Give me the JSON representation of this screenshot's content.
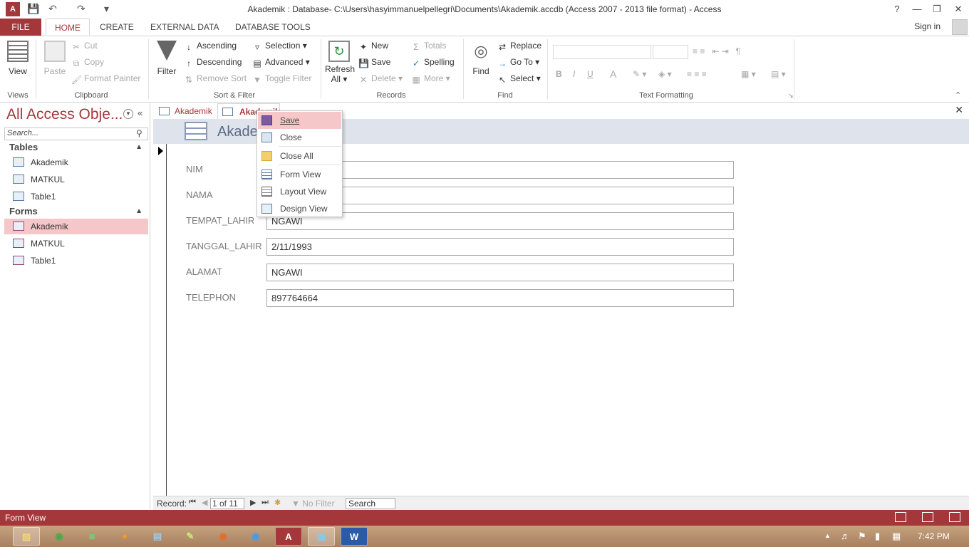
{
  "title_bar": {
    "app_icon": "A",
    "title": "Akademik : Database- C:\\Users\\hasyimmanuelpellegri\\Documents\\Akademik.accdb (Access 2007 - 2013 file format) - Access",
    "help": "?"
  },
  "ribbon_tabs": [
    "FILE",
    "HOME",
    "CREATE",
    "EXTERNAL DATA",
    "DATABASE TOOLS"
  ],
  "sign_in": "Sign in",
  "ribbon": {
    "views": {
      "view": "View",
      "label": "Views"
    },
    "clipboard": {
      "paste": "Paste",
      "cut": "Cut",
      "copy": "Copy",
      "format_painter": "Format Painter",
      "label": "Clipboard"
    },
    "sort_filter": {
      "filter": "Filter",
      "ascending": "Ascending",
      "descending": "Descending",
      "remove_sort": "Remove Sort",
      "selection": "Selection",
      "advanced": "Advanced",
      "toggle_filter": "Toggle Filter",
      "label": "Sort & Filter"
    },
    "records": {
      "refresh": "Refresh",
      "refresh_all": "All",
      "new": "New",
      "save": "Save",
      "delete": "Delete",
      "totals": "Totals",
      "spelling": "Spelling",
      "more": "More",
      "label": "Records"
    },
    "find": {
      "find": "Find",
      "replace": "Replace",
      "goto": "Go To",
      "select": "Select",
      "label": "Find"
    },
    "text_formatting": {
      "bold": "B",
      "italic": "I",
      "underline": "U",
      "font_color": "A",
      "label": "Text Formatting"
    }
  },
  "nav_pane": {
    "title": "All Access Obje...",
    "search_placeholder": "Search...",
    "sections": [
      {
        "name": "Tables",
        "items": [
          "Akademik",
          "MATKUL",
          "Table1"
        ]
      },
      {
        "name": "Forms",
        "items": [
          "Akademik",
          "MATKUL",
          "Table1"
        ]
      }
    ]
  },
  "doc_tabs": [
    "Akademik",
    "Akademik"
  ],
  "form": {
    "title": "Akade",
    "fields": [
      {
        "label": "NIM",
        "value": ""
      },
      {
        "label": "NAMA",
        "value": ""
      },
      {
        "label": "TEMPAT_LAHIR",
        "value": "NGAWI"
      },
      {
        "label": "TANGGAL_LAHIR",
        "value": "2/11/1993"
      },
      {
        "label": "ALAMAT",
        "value": "NGAWI"
      },
      {
        "label": "TELEPHON",
        "value": "897764664"
      }
    ]
  },
  "record_nav": {
    "label": "Record:",
    "position": "1 of 11",
    "filter": "No Filter",
    "search": "Search"
  },
  "context_menu": [
    "Save",
    "Close",
    "Close All",
    "Form View",
    "Layout View",
    "Design View"
  ],
  "status_bar": {
    "text": "Form View"
  },
  "taskbar": {
    "clock": "7:42 PM"
  },
  "colors": {
    "accent": "#a4373a",
    "highlight": "#f6c7c8",
    "form_header": "#dfe3ec"
  }
}
